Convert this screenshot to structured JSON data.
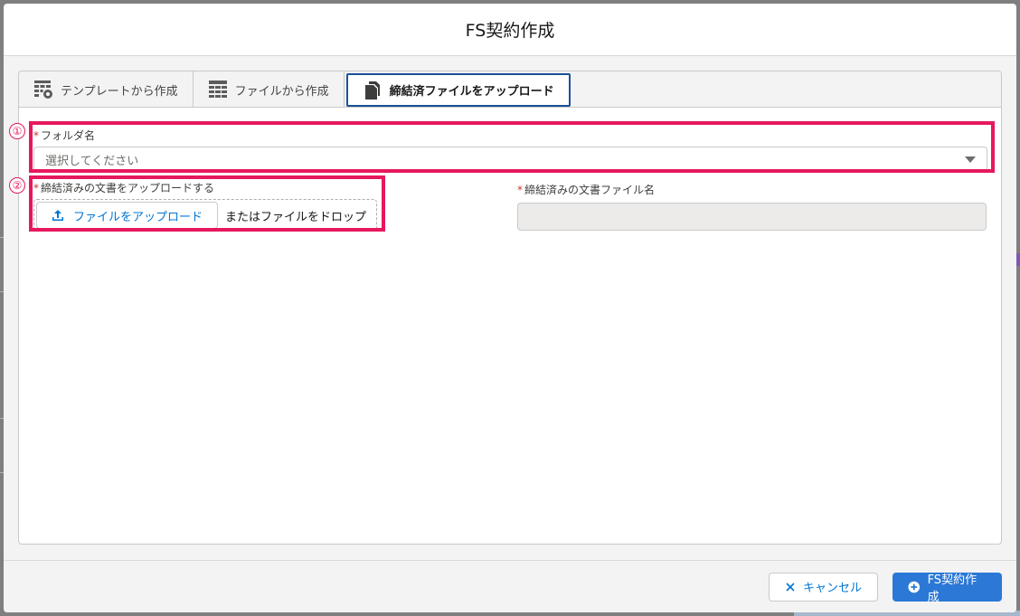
{
  "modal": {
    "title": "FS契約作成"
  },
  "tabs": [
    {
      "label": "テンプレートから作成",
      "icon": "template-table-icon",
      "active": false
    },
    {
      "label": "ファイルから作成",
      "icon": "table-grid-icon",
      "active": false
    },
    {
      "label": "締結済ファイルをアップロード",
      "icon": "copy-document-icon",
      "active": true
    }
  ],
  "form": {
    "required_marker": "*",
    "folder": {
      "label": "フォルダ名",
      "placeholder": "選択してください"
    },
    "upload": {
      "label": "締結済みの文書をアップロードする",
      "button_label": "ファイルをアップロード",
      "drop_text": "またはファイルをドロップ"
    },
    "filename": {
      "label": "締結済みの文書ファイル名",
      "value": ""
    }
  },
  "annotations": {
    "marker_1": "①",
    "marker_2": "②"
  },
  "footer": {
    "cancel_label": "キャンセル",
    "create_label": "FS契約作成"
  },
  "colors": {
    "annotation": "#e6185e",
    "brand": "#2b78d6",
    "link": "#0176d3",
    "tab_active_border": "#1b5297"
  }
}
